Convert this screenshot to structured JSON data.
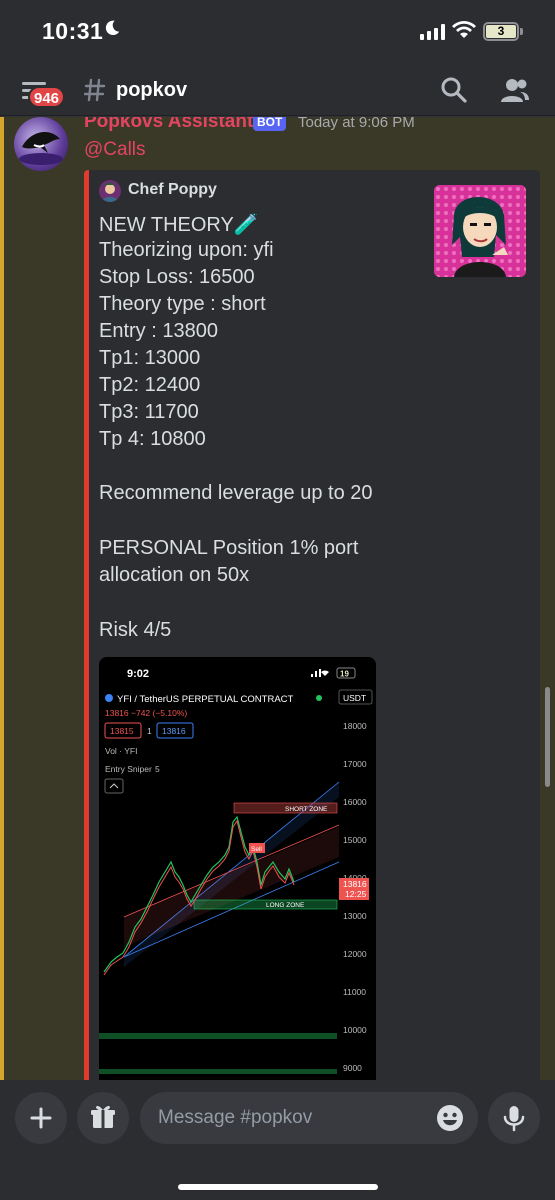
{
  "status_bar": {
    "time": "10:31",
    "battery": "3"
  },
  "header": {
    "unread_badge": "946",
    "channel_name": "popkov"
  },
  "message": {
    "author": "Popkovs Assistant",
    "bot_tag": "BOT",
    "timestamp": "Today at 9:06 PM",
    "mention": "@Calls",
    "embed": {
      "author": "Chef Poppy",
      "lines": [
        "NEW THEORY🧪",
        "Theorizing upon: yfi",
        "Stop Loss: 16500",
        "Theory type : short",
        "Entry : 13800",
        "Tp1: 13000",
        "Tp2: 12400",
        "Tp3: 11700",
        "Tp 4: 10800",
        "",
        "Recommend leverage up to 20",
        "",
        "PERSONAL Position 1% port",
        "allocation on 50x",
        "",
        "Risk 4/5"
      ]
    },
    "chart_image": {
      "time": "9:02",
      "battery": "19",
      "pair": "YFI / TetherUS PERPETUAL CONTRACT",
      "currency": "USDT",
      "price_line": "13816 −742 (−5.10%)",
      "bid": "13815",
      "qty": "1",
      "ask": "13816",
      "vol_label": "Vol · YFI",
      "indicator": "Entry Sniper",
      "indicator_val": "5",
      "short_zone": "SHORT ZONE",
      "long_zone": "LONG ZONE",
      "sell_label": "Sell",
      "price_tag": "13816",
      "price_tag_time": "12:25",
      "y_ticks": [
        "18000",
        "17000",
        "16000",
        "15000",
        "14000",
        "13000",
        "12000",
        "11000",
        "10000",
        "9000"
      ]
    }
  },
  "composer": {
    "placeholder": "Message #popkov"
  },
  "colors": {
    "background": "#313338",
    "mention_highlight": "#3a3826",
    "embed_accent": "#e03b2c",
    "bot_tag": "#5865f2",
    "author": "#e24563"
  }
}
